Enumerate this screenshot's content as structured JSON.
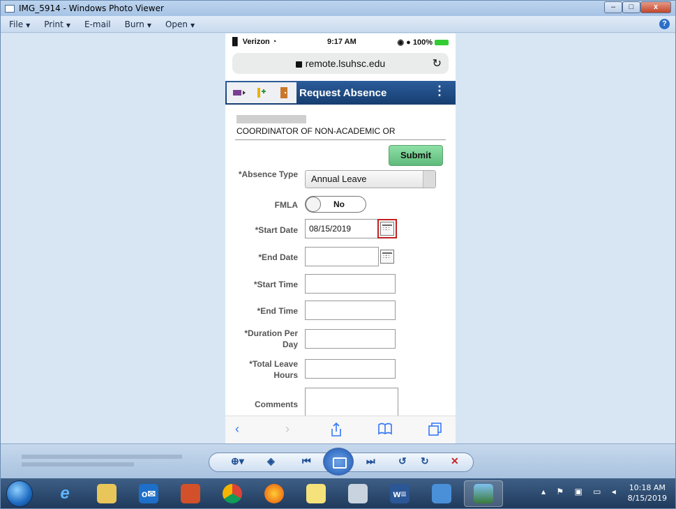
{
  "window": {
    "title": "IMG_5914 - Windows Photo Viewer",
    "controls": {
      "minimize": "–",
      "maximize": "□",
      "close": "x"
    }
  },
  "menu": {
    "items": [
      {
        "label": "File",
        "arrow": "▼"
      },
      {
        "label": "Print",
        "arrow": "▼"
      },
      {
        "label": "E-mail",
        "arrow": ""
      },
      {
        "label": "Burn",
        "arrow": "▼"
      },
      {
        "label": "Open",
        "arrow": "▼"
      }
    ],
    "help": "?"
  },
  "phone": {
    "status": {
      "carrier": "▐▌ Verizon ◔",
      "time": "9:17 AM",
      "battery": "◉ ● 100%"
    },
    "url": "remote.lsuhsc.edu",
    "reload": "↻",
    "app_title": "Request Absence",
    "kebab": "⋮",
    "job_title": "COORDINATOR OF NON-ACADEMIC OR",
    "submit": "Submit",
    "form": {
      "absence_type_label": "*Absence Type",
      "absence_type_value": "Annual Leave",
      "fmla_label": "FMLA",
      "fmla_value": "No",
      "start_date_label": "*Start Date",
      "start_date_value": "08/15/2019",
      "end_date_label": "*End Date",
      "end_date_value": "",
      "start_time_label": "*Start Time",
      "end_time_label": "*End Time",
      "duration_label": "*Duration Per Day",
      "total_hours_label": "*Total Leave Hours",
      "comments_label": "Comments"
    },
    "safari": {
      "back": "‹",
      "forward": "›"
    }
  },
  "taskbar": {
    "outlook_label": "o✉",
    "word_label": "w≡",
    "clock_time": "10:18 AM",
    "clock_date": "8/15/2019"
  }
}
